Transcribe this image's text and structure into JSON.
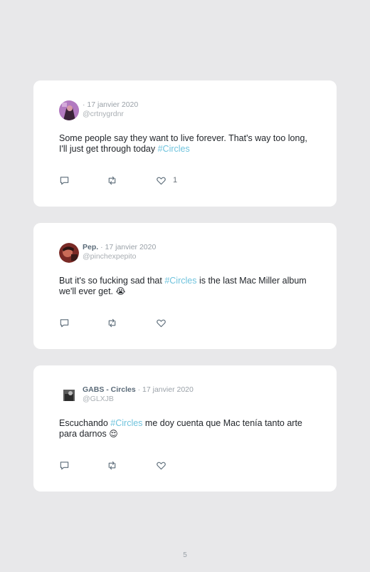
{
  "tweets": [
    {
      "name": "",
      "date": "· 17 janvier 2020",
      "handle": "@crtnygrdnr",
      "text_before": "Some people say they want to live forever. That's way too long, I'll just get through today ",
      "hashtag": "#Circles",
      "text_after": "",
      "emoji": "",
      "likes": "1",
      "avatar_icon": "avatar-purple-photo"
    },
    {
      "name": "Pep.",
      "date": "· 17 janvier 2020",
      "handle": "@pinchexpepito",
      "text_before": "But it's so fucking sad that ",
      "hashtag": "#Circles",
      "text_after": " is the last Mac Miller album we'll ever get. ",
      "emoji": "😭",
      "likes": "",
      "avatar_icon": "avatar-red-photo"
    },
    {
      "name": "GABS - Circles",
      "date": "· 17 janvier 2020",
      "handle": "@GLXJB",
      "text_before": "Escuchando ",
      "hashtag": "#Circles",
      "text_after": " me doy cuenta que Mac tenía tanto arte para darnos ",
      "emoji": "😌",
      "likes": "",
      "avatar_icon": "avatar-bw-photo"
    }
  ],
  "page_number": "5",
  "colors": {
    "hashtag": "#6fc3dd",
    "background": "#e8e8ea",
    "card": "#ffffff"
  },
  "icons": [
    "reply-icon",
    "retweet-icon",
    "like-icon"
  ]
}
